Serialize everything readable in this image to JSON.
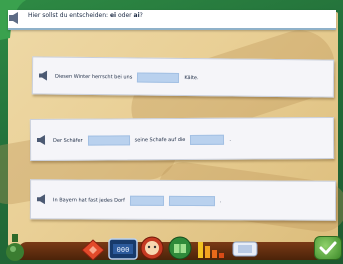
{
  "header": {
    "instruction_prefix": "Hier sollst du entscheiden: ",
    "option_a": "ei",
    "conjunction": " oder ",
    "option_b": "ai",
    "suffix": "?"
  },
  "sentences": [
    {
      "before": "Diesen Winter herrscht bei uns",
      "after": "Kälte."
    },
    {
      "before": "Der Schäfer",
      "middle": "seine Schafe auf die",
      "after": "."
    },
    {
      "before": "In Bayern hat fast jedes Dorf",
      "after": "."
    }
  ],
  "toolbar": {
    "icons": [
      "bottle-icon",
      "home-arrow-icon",
      "number-display-icon",
      "face-help-icon",
      "green-book-icon",
      "bar-chart-icon",
      "dictionary-icon",
      "checkmark-icon"
    ]
  },
  "colors": {
    "background_green": "#2e8a44",
    "wood": "#e9cf95",
    "card": "#f5f5f9",
    "blank": "#b9d1ee",
    "text": "#1b2a44"
  }
}
